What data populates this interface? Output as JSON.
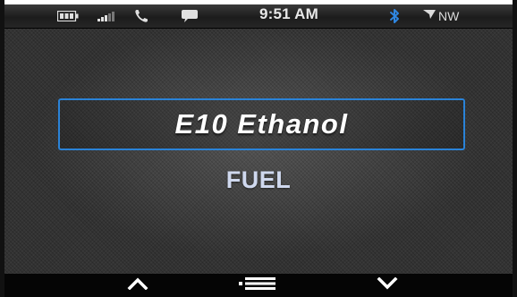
{
  "status_bar": {
    "time": "9:51 AM",
    "compass_heading": "NW",
    "icons": {
      "battery": "battery-icon",
      "signal": "signal-strength-icon",
      "phone": "phone-icon",
      "message": "message-bubble-icon",
      "bluetooth": "bluetooth-icon",
      "compass": "compass-arrow-icon"
    }
  },
  "main": {
    "selected_value": "E10 Ethanol",
    "setting_label": "FUEL"
  },
  "bottom_bar": {
    "icons": {
      "up": "chevron-up-icon",
      "menu": "menu-icon",
      "down": "chevron-down-icon"
    }
  },
  "colors": {
    "selection_border": "#2a83d8",
    "bluetooth": "#2f86e0",
    "label_text": "#cfd8ee",
    "value_text": "#ffffff"
  }
}
